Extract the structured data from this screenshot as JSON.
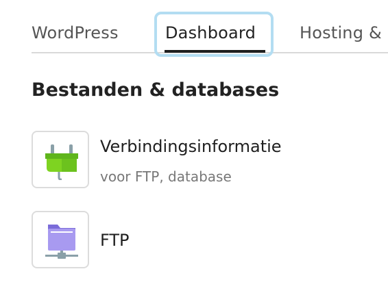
{
  "tabs": [
    {
      "label": "WordPress"
    },
    {
      "label": "Dashboard",
      "active": true
    },
    {
      "label": "Hosting &"
    }
  ],
  "section": {
    "title": "Bestanden & databases",
    "items": [
      {
        "title": "Verbindingsinformatie",
        "subtitle": "voor FTP, database",
        "icon": "plug-icon"
      },
      {
        "title": "FTP",
        "icon": "network-folder-icon"
      }
    ]
  },
  "colors": {
    "plug_green": "#7ed321",
    "folder_purple": "#a89af0",
    "focus_ring": "#b3ddf2"
  }
}
